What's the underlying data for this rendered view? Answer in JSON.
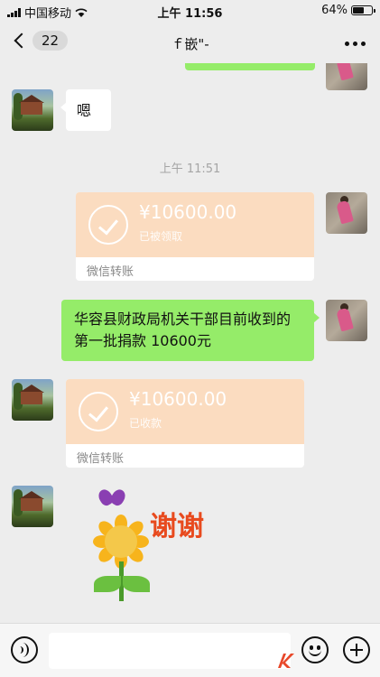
{
  "status_bar": {
    "carrier": "中国移动",
    "time": "上午 11:56",
    "battery": "64%",
    "battery_level": 0.64
  },
  "nav": {
    "back_count": "22",
    "title": "ｆ嵌\"-"
  },
  "messages": {
    "reply_text": "嗯",
    "timestamp": "上午 11:51",
    "transfer_1": {
      "amount": "¥10600.00",
      "status": "已被领取",
      "label": "微信转账"
    },
    "text_message": "华容县财政局机关干部目前收到的第一批捐款 10600元",
    "transfer_2": {
      "amount": "¥10600.00",
      "status": "已收款",
      "label": "微信转账"
    },
    "sticker_text": "谢谢"
  },
  "colors": {
    "background": "#ededed",
    "self_bubble": "#95ec69",
    "transfer_card": "#fbdcc0",
    "sticker_text": "#e84a1e"
  },
  "icons": [
    "signal-icon",
    "wifi-icon",
    "battery-icon",
    "back-chevron-icon",
    "more-icon",
    "voice-icon",
    "emoji-icon",
    "plus-icon"
  ]
}
